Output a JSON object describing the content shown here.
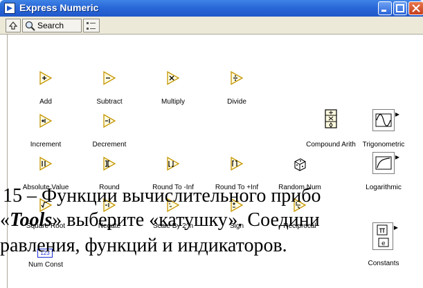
{
  "window": {
    "title": "Express Numeric",
    "minimize_label": "minimize",
    "maximize_label": "maximize",
    "close_label": "close"
  },
  "toolbar": {
    "search_label": "Search"
  },
  "palette": {
    "add": "Add",
    "subtract": "Subtract",
    "multiply": "Multiply",
    "divide": "Divide",
    "increment": "Increment",
    "decrement": "Decrement",
    "compound_arith": "Compound Arith",
    "trigonometric": "Trigonometric",
    "absolute_value": "Absolute Value",
    "round": "Round",
    "round_neg_inf": "Round To -Inf",
    "round_pos_inf": "Round To +Inf",
    "random_num": "Random Num",
    "logarithmic": "Logarithmic",
    "square_root": "Square Root",
    "negate": "Negate",
    "scale_by_2": "Scale By 2^n",
    "sign": "Sign",
    "reciprocal": "Reciprocal",
    "num_const": "Num Const",
    "num_const_value": "123",
    "constants": "Constants"
  },
  "overlay_text": {
    "line1": "15 – Функции вычислительного прибо",
    "line2_prefix": "«",
    "line2_tools": "Tools",
    "line2_suffix": "» выберите «катушку». Соедини",
    "line3": "равления, функций и индикаторов."
  }
}
